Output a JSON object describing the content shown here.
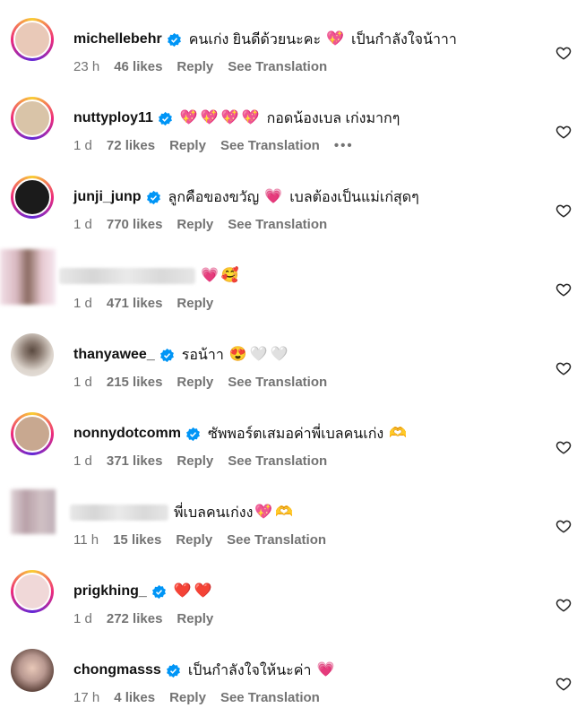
{
  "comments": [
    {
      "username": "michellebehr",
      "verified": true,
      "text": "คนเก่ง ยินดีด้วยนะคะ",
      "emojis": [
        "💖"
      ],
      "text2": "เป็นกำลังใจน้าาา",
      "time": "23 h",
      "likes": "46 likes",
      "reply": "Reply",
      "translate": "See Translation",
      "more": "",
      "avatar_color": "#e9c9b8"
    },
    {
      "username": "nuttyploy11",
      "verified": true,
      "text": "",
      "emojis": [
        "💖",
        "💖",
        "💖",
        "💖"
      ],
      "text2": "กอดน้องเบล เก่งมากๆ",
      "time": "1 d",
      "likes": "72 likes",
      "reply": "Reply",
      "translate": "See Translation",
      "more": "•••",
      "avatar_color": "#d9c4a8"
    },
    {
      "username": "junji_junp",
      "verified": true,
      "text": "ลูกคือของขวัญ",
      "emojis": [
        "💗"
      ],
      "text2": "เบลต้องเป็นแม่เก่สุดๆ",
      "time": "1 d",
      "likes": "770 likes",
      "reply": "Reply",
      "translate": "See Translation",
      "more": "",
      "avatar_color": "#1b1b1b"
    },
    {
      "username": "",
      "verified": false,
      "text": "",
      "emojis": [
        "💗",
        "🥰"
      ],
      "text2": "",
      "time": "1 d",
      "likes": "471 likes",
      "reply": "Reply",
      "translate": "",
      "more": "",
      "avatar_color": "#c9a8b0"
    },
    {
      "username": "thanyawee_",
      "verified": true,
      "text": "รอน้าา",
      "emojis": [
        "😍",
        "🤍",
        "🤍"
      ],
      "text2": "",
      "time": "1 d",
      "likes": "215 likes",
      "reply": "Reply",
      "translate": "See Translation",
      "more": "",
      "avatar_color": "#d8d0c8"
    },
    {
      "username": "nonnydotcomm",
      "verified": true,
      "text": "ซัพพอร์ตเสมอค่าพี่เบลคนเก่ง",
      "emojis": [
        "🫶"
      ],
      "text2": "",
      "time": "1 d",
      "likes": "371 likes",
      "reply": "Reply",
      "translate": "See Translation",
      "more": "",
      "avatar_color": "#c8a890"
    },
    {
      "username": "",
      "verified": false,
      "text": "พี่เบลคนเก่งง",
      "emojis": [
        "💖",
        "🫶"
      ],
      "text2": "",
      "time": "11 h",
      "likes": "15 likes",
      "reply": "Reply",
      "translate": "See Translation",
      "more": "",
      "avatar_color": "#c0b0b8"
    },
    {
      "username": "prigkhing_",
      "verified": true,
      "text": "",
      "emojis": [
        "❤️",
        "❤️"
      ],
      "text2": "",
      "time": "1 d",
      "likes": "272 likes",
      "reply": "Reply",
      "translate": "",
      "more": "",
      "avatar_color": "#f0d8d8"
    },
    {
      "username": "chongmasss",
      "verified": true,
      "text": "เป็นกำลังใจให้นะค่า",
      "emojis": [
        "💗"
      ],
      "text2": "",
      "time": "17 h",
      "likes": "4 likes",
      "reply": "Reply",
      "translate": "See Translation",
      "more": "",
      "avatar_color": "#b89890"
    }
  ],
  "colors": {
    "meta": "#737373",
    "verified": "#0095f6"
  }
}
